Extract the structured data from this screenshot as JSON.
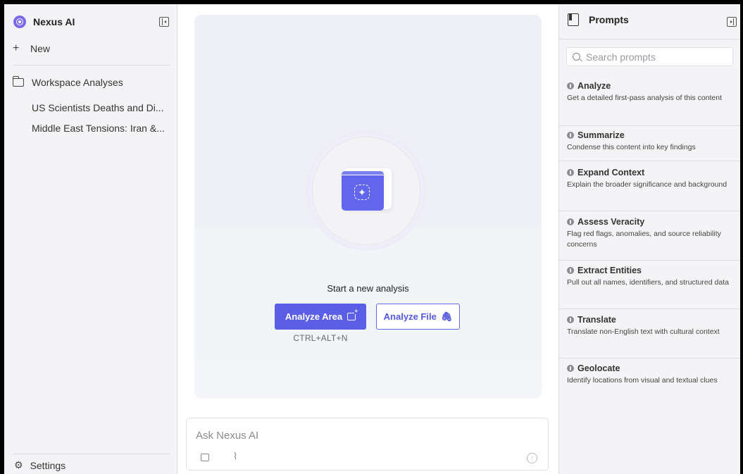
{
  "left_sidebar": {
    "brand": "Nexus AI",
    "new_label": "New",
    "folder_label": "Workspace Analyses",
    "threads": [
      "US Scientists Deaths and Di...",
      "Middle East Tensions: Iran &..."
    ],
    "settings_label": "Settings"
  },
  "center": {
    "start_text": "Start a new analysis",
    "analyze_area_label": "Analyze Area",
    "analyze_file_label": "Analyze File",
    "shortcut": "CTRL+ALT+N",
    "ask_placeholder": "Ask Nexus AI"
  },
  "right_panel": {
    "title": "Prompts",
    "search_placeholder": "Search prompts",
    "prompts": [
      {
        "title": "Analyze",
        "description": "Get a detailed first-pass analysis of this content"
      },
      {
        "title": "Summarize",
        "description": "Condense this content into key findings"
      },
      {
        "title": "Expand Context",
        "description": "Explain the broader significance and background"
      },
      {
        "title": "Assess Veracity",
        "description": "Flag red flags, anomalies, and source reliability concerns"
      },
      {
        "title": "Extract Entities",
        "description": "Pull out all names, identifiers, and structured data"
      },
      {
        "title": "Translate",
        "description": "Translate non-English text with cultural context"
      },
      {
        "title": "Geolocate",
        "description": "Identify locations from visual and textual clues"
      }
    ]
  },
  "colors": {
    "accent": "#5b5fe8",
    "sidebar_bg": "#f4f4f6",
    "main_bg": "#ffffff"
  },
  "icons": [
    "brand-logo-icon",
    "collapse-sidebar-icon",
    "plus-icon",
    "folder-icon",
    "gear-icon",
    "book-icon",
    "search-icon",
    "crop-icon",
    "paperclip-icon",
    "image-icon",
    "send-icon"
  ]
}
